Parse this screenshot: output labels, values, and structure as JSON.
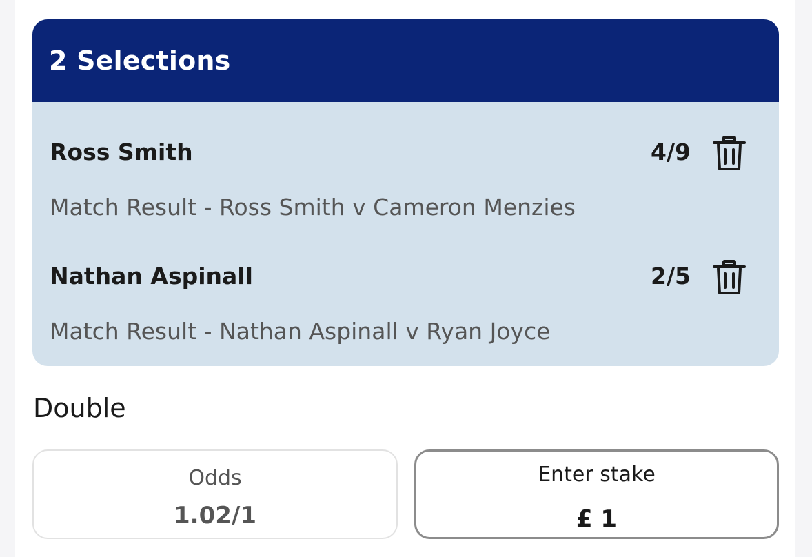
{
  "header": {
    "title": "2 Selections"
  },
  "selections": [
    {
      "name": "Ross Smith",
      "odds": "4/9",
      "market": "Match Result - Ross Smith v Cameron Menzies"
    },
    {
      "name": "Nathan Aspinall",
      "odds": "2/5",
      "market": "Match Result - Nathan Aspinall v Ryan Joyce"
    }
  ],
  "bet": {
    "type": "Double",
    "odds_label": "Odds",
    "odds_value": "1.02/1",
    "stake_label": "Enter stake",
    "stake_value": "£ 1"
  },
  "icons": {
    "remove": "trash-icon"
  },
  "colors": {
    "header_bg": "#0b2577",
    "card_bg": "#d3e1ec",
    "stake_border": "#8c8c8c"
  }
}
